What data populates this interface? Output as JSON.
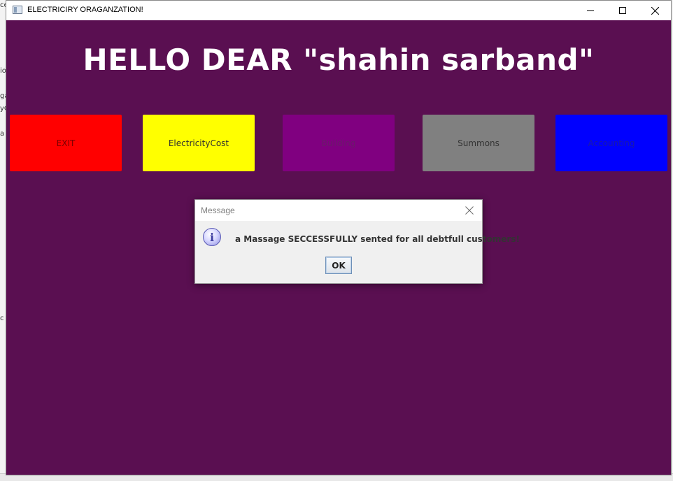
{
  "window": {
    "title": "ELECTRICIRY ORAGANZATION!",
    "controls": [
      "minimize",
      "maximize",
      "close"
    ]
  },
  "background": {
    "left_fragments": [
      "ce",
      "io",
      "ga",
      "yC",
      "a",
      "c",
      "i"
    ]
  },
  "main": {
    "greeting": "HELLO DEAR \"shahin sarband\"",
    "background_color": "#5a0f51",
    "buttons": [
      {
        "label": "EXIT",
        "bg": "#ff0000",
        "fg": "#7a0000"
      },
      {
        "label": "ElectricityCost",
        "bg": "#ffff00",
        "fg": "#2f2f2f"
      },
      {
        "label": "Building",
        "bg": "#800080",
        "fg": "#6a1a6a"
      },
      {
        "label": "Summons",
        "bg": "#808080",
        "fg": "#333333"
      },
      {
        "label": "Accounting",
        "bg": "#0000ff",
        "fg": "#1a1aa8"
      }
    ]
  },
  "dialog": {
    "title": "Message",
    "icon": "info-icon",
    "message": "a Massage SECCESSFULLY sented for all debtfull customers!",
    "ok_label": "OK"
  }
}
